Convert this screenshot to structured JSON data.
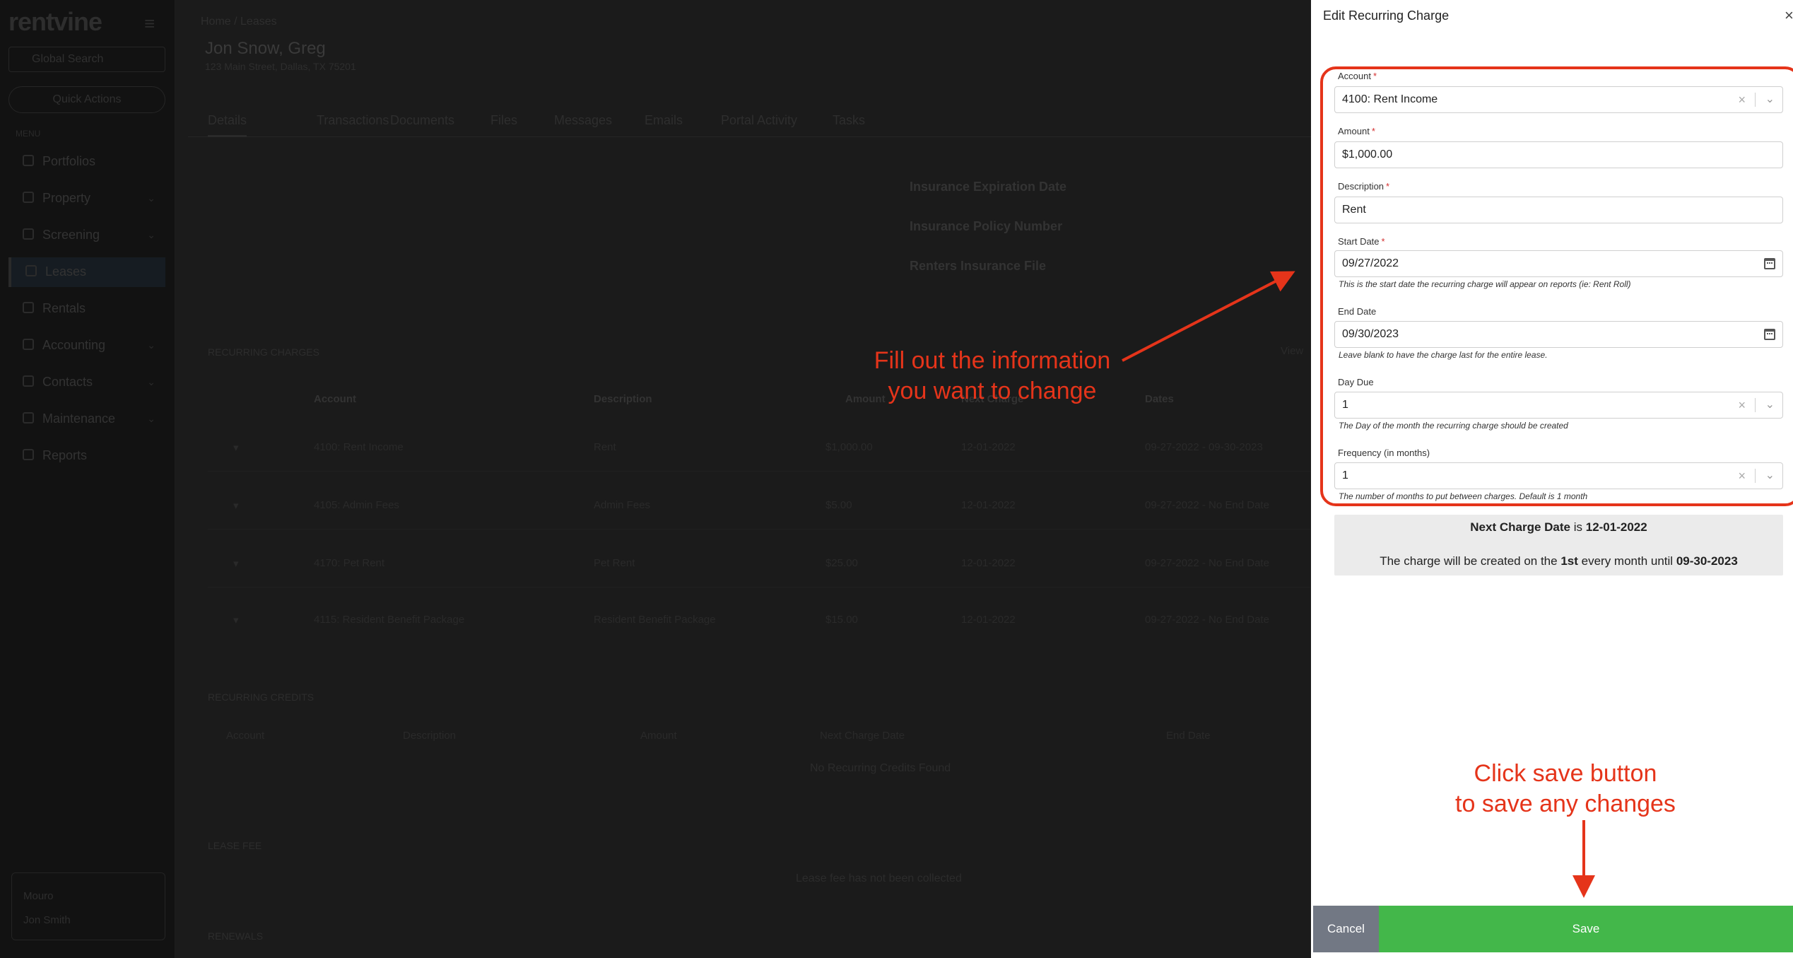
{
  "background": {
    "logo": "rentvine",
    "search_placeholder": "Global Search",
    "quick_actions": "Quick Actions",
    "menu_label": "MENU",
    "nav": [
      "Portfolios",
      "Property",
      "Screening",
      "Leases",
      "Rentals",
      "Accounting",
      "Contacts",
      "Maintenance",
      "Reports"
    ],
    "user_name": "Mouro",
    "user_sub": "Jon Smith",
    "breadcrumb": "Home / Leases",
    "tenant_name": "Jon Snow, Greg",
    "tenant_address": "123 Main Street, Dallas, TX 75201",
    "tabs": [
      "Details",
      "Transactions",
      "Documents",
      "Files",
      "Messages",
      "Emails",
      "Portal Activity",
      "Tasks"
    ],
    "insurance_fields": [
      "Insurance Expiration Date",
      "Insurance Policy Number",
      "Renters Insurance File"
    ],
    "recurring_charges_label": "RECURRING CHARGES",
    "view_all": "View",
    "charges_headers": [
      "Account",
      "Description",
      "Amount",
      "Next Charge",
      "Dates"
    ],
    "charges_rows": [
      [
        "4100: Rent Income",
        "Rent",
        "$1,000.00",
        "12-01-2022",
        "09-27-2022 - 09-30-2023"
      ],
      [
        "4105: Admin Fees",
        "Admin Fees",
        "$5.00",
        "12-01-2022",
        "09-27-2022 - No End Date"
      ],
      [
        "4170: Pet Rent",
        "Pet Rent",
        "$25.00",
        "12-01-2022",
        "09-27-2022 - No End Date"
      ],
      [
        "4115: Resident Benefit Package",
        "Resident Benefit Package",
        "$15.00",
        "12-01-2022",
        "09-27-2022 - No End Date"
      ]
    ],
    "recurring_credits_label": "RECURRING CREDITS",
    "credits_headers": [
      "Account",
      "Description",
      "Amount",
      "Next Charge Date",
      "End Date"
    ],
    "credits_empty": "No Recurring Credits Found",
    "lease_fee_label": "LEASE FEE",
    "lease_fee_empty": "Lease fee has not been collected",
    "renewals_label": "RENEWALS"
  },
  "panel": {
    "title": "Edit Recurring Charge",
    "close": "×",
    "account": {
      "label": "Account",
      "value": "4100: Rent Income"
    },
    "amount": {
      "label": "Amount",
      "value": "$1,000.00"
    },
    "description": {
      "label": "Description",
      "value": "Rent"
    },
    "start_date": {
      "label": "Start Date",
      "value": "09/27/2022",
      "help": "This is the start date the recurring charge will appear on reports (ie: Rent Roll)"
    },
    "end_date": {
      "label": "End Date",
      "value": "09/30/2023",
      "help": "Leave blank to have the charge last for the entire lease."
    },
    "day_due": {
      "label": "Day Due",
      "value": "1",
      "help": "The Day of the month the recurring charge should be created"
    },
    "frequency": {
      "label": "Frequency (in months)",
      "value": "1",
      "help": "The number of months to put between charges. Default is 1 month"
    },
    "required_mark": "*",
    "summary": {
      "next_label": "Next Charge Date",
      "next_is": " is ",
      "next_value": "12-01-2022",
      "line2_a": "The charge will be created on the ",
      "line2_day": "1st",
      "line2_b": " every month until ",
      "line2_until": "09-30-2023"
    },
    "cancel_label": "Cancel",
    "save_label": "Save"
  },
  "annotations": {
    "fill_note_1": "Fill out the information",
    "fill_note_2": "you want to change",
    "save_note_1": "Click save button",
    "save_note_2": "to save any changes",
    "color": "#e5341a"
  },
  "colors": {
    "save": "#43b74a",
    "cancel": "#727884",
    "required": "#d32f2f"
  }
}
